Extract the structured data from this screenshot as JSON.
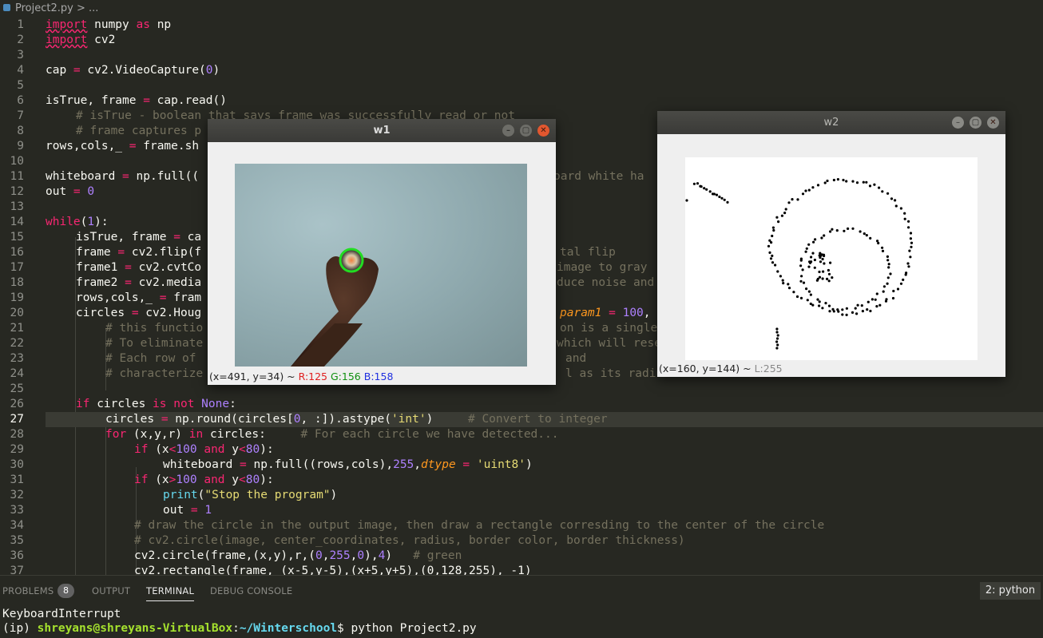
{
  "breadcrumb": {
    "file": "Project2.py",
    "sep": ">",
    "rest": "..."
  },
  "editor": {
    "active_line": 27,
    "lines": [
      {
        "n": "1",
        "indent": 0
      },
      {
        "n": "2",
        "indent": 0
      },
      {
        "n": "3",
        "indent": 0
      },
      {
        "n": "4",
        "indent": 0
      },
      {
        "n": "5",
        "indent": 0
      },
      {
        "n": "6",
        "indent": 0
      },
      {
        "n": "7",
        "indent": 1
      },
      {
        "n": "8",
        "indent": 1
      },
      {
        "n": "9",
        "indent": 0
      },
      {
        "n": "10",
        "indent": 0
      },
      {
        "n": "11",
        "indent": 0
      },
      {
        "n": "12",
        "indent": 0
      },
      {
        "n": "13",
        "indent": 0
      },
      {
        "n": "14",
        "indent": 0
      },
      {
        "n": "15",
        "indent": 1
      },
      {
        "n": "16",
        "indent": 1
      },
      {
        "n": "17",
        "indent": 1
      },
      {
        "n": "18",
        "indent": 1
      },
      {
        "n": "19",
        "indent": 1
      },
      {
        "n": "20",
        "indent": 1
      },
      {
        "n": "21",
        "indent": 2
      },
      {
        "n": "22",
        "indent": 2
      },
      {
        "n": "23",
        "indent": 2
      },
      {
        "n": "24",
        "indent": 2
      },
      {
        "n": "25",
        "indent": 1
      },
      {
        "n": "26",
        "indent": 1
      },
      {
        "n": "27",
        "indent": 2
      },
      {
        "n": "28",
        "indent": 2
      },
      {
        "n": "29",
        "indent": 3
      },
      {
        "n": "30",
        "indent": 4
      },
      {
        "n": "31",
        "indent": 3
      },
      {
        "n": "32",
        "indent": 4
      },
      {
        "n": "33",
        "indent": 4
      },
      {
        "n": "34",
        "indent": 3
      },
      {
        "n": "35",
        "indent": 3
      },
      {
        "n": "36",
        "indent": 3
      },
      {
        "n": "37",
        "indent": 3
      }
    ],
    "code": {
      "l1": [
        "import",
        " numpy ",
        "as",
        " np"
      ],
      "l2": [
        "import",
        " cv2"
      ],
      "l4": [
        "cap ",
        "=",
        " cv2.VideoCapture(",
        "0",
        ")"
      ],
      "l6": [
        "isTrue, frame ",
        "=",
        " cap.read()"
      ],
      "l7": "# isTrue - boolean that says frame was successfully read or not",
      "l8": "# frame captures p",
      "l9": [
        "rows,cols,_ ",
        "=",
        " frame.sh"
      ],
      "l11": [
        "whiteboard ",
        "=",
        " np.full(("
      ],
      "l11r": "oard white ha",
      "l12": [
        "out ",
        "=",
        " ",
        "0"
      ],
      "l14": [
        "while",
        "(",
        "1",
        "):"
      ],
      "l15": [
        "isTrue, frame ",
        "=",
        " ca"
      ],
      "l16": [
        "frame ",
        "=",
        " cv2.flip(f"
      ],
      "l16r": "tal flip",
      "l17": [
        "frame1 ",
        "=",
        " cv2.cvtCo"
      ],
      "l17r": "image to gray",
      "l18": [
        "frame2 ",
        "=",
        " cv2.media"
      ],
      "l18r": "duce noise and",
      "l19": [
        "rows,cols,_ ",
        "=",
        " fram"
      ],
      "l20": [
        "circles ",
        "=",
        " cv2.Houg"
      ],
      "l20r": [
        "param1",
        " ",
        "=",
        " ",
        "100",
        ","
      ],
      "l21": "# this functio",
      "l21r": "on is a single",
      "l22": "# To eliminate",
      "l22r": "which will rese",
      "l23": "# Each row of",
      "l23r": "and",
      "l24": "# characterize",
      "l24r": "l as its radius.",
      "l26": [
        "if",
        " circles ",
        "is not",
        " ",
        "None",
        ":"
      ],
      "l27": [
        "circles ",
        "=",
        " np.round(circles[",
        "0",
        ", :]).astype(",
        "'int'",
        ")",
        "     # Convert to integer"
      ],
      "l28": [
        "for",
        " (x,y,r) ",
        "in",
        " circles:",
        "     # For each circle we have detected..."
      ],
      "l29": [
        "if",
        " (x",
        "<",
        "100",
        " ",
        "and",
        " y",
        "<",
        "80",
        "):"
      ],
      "l30": [
        "whiteboard ",
        "=",
        " np.full((rows,cols),",
        "255",
        ",",
        "dtype",
        " ",
        "=",
        " ",
        "'uint8'",
        ")"
      ],
      "l31": [
        "if",
        " (x",
        ">",
        "100",
        " ",
        "and",
        " y",
        "<",
        "80",
        "):"
      ],
      "l32": [
        "print",
        "(",
        "\"Stop the program\"",
        ")"
      ],
      "l33": [
        "out ",
        "=",
        " ",
        "1"
      ],
      "l34": "# draw the circle in the output image, then draw a rectangle corresding to the center of the circle",
      "l35": "# cv2.circle(image, center_coordinates, radius, border color, border thickness)",
      "l36": [
        "cv2.circle(frame,(x,y),r,(",
        "0",
        ",",
        "255",
        ",",
        "0",
        "),",
        "4",
        ")",
        "   # green"
      ],
      "l37": [
        "cv2.rectangle(frame, (x-5,y-5),(x+5,y+5),(0,128,255), -1)"
      ]
    }
  },
  "w1": {
    "title": "w1",
    "status_coords": "(x=491, y=34) ~",
    "r": "R:125",
    "g": "G:156",
    "b": "B:158"
  },
  "w2": {
    "title": "w2",
    "status_coords": "(x=160, y=144) ~",
    "l": "L:255"
  },
  "window_buttons": {
    "minimize": "–",
    "maximize": "▢",
    "close": "✕"
  },
  "panel": {
    "tabs": [
      "PROBLEMS",
      "OUTPUT",
      "TERMINAL",
      "DEBUG CONSOLE"
    ],
    "active_tab": "TERMINAL",
    "problems_count": "8",
    "terminal_selector": "2: python"
  },
  "terminal": {
    "line1": "KeyboardInterrupt",
    "env": "(ip) ",
    "user_host": "shreyans@shreyans-VirtualBox",
    "colon": ":",
    "path": "~/Winterschool",
    "prompt_cmd": "$ python Project2.py"
  },
  "colors": {
    "editor_bg": "#272822",
    "keyword": "#f92672",
    "number": "#ae81ff",
    "string": "#e6db74",
    "comment": "#75715e",
    "builtin": "#66d9ef",
    "param": "#fd971f",
    "detect_circle": "#22dd22",
    "close_button": "#e2572f"
  }
}
